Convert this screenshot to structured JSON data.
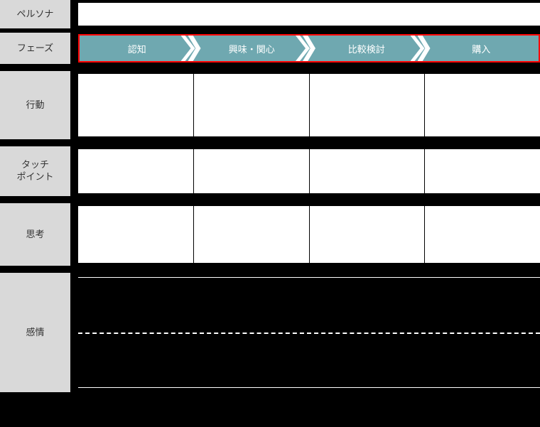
{
  "rows": {
    "persona": "ペルソナ",
    "phase": "フェーズ",
    "action": "行動",
    "touchpoint_line1": "タッチ",
    "touchpoint_line2": "ポイント",
    "thinking": "思考",
    "emotion": "感情"
  },
  "phases": [
    "認知",
    "興味・関心",
    "比較検討",
    "購入"
  ],
  "colors": {
    "phase_bg": "#6fa8b0",
    "phase_border": "#ff0000",
    "label_bg": "#d9d9d9"
  }
}
